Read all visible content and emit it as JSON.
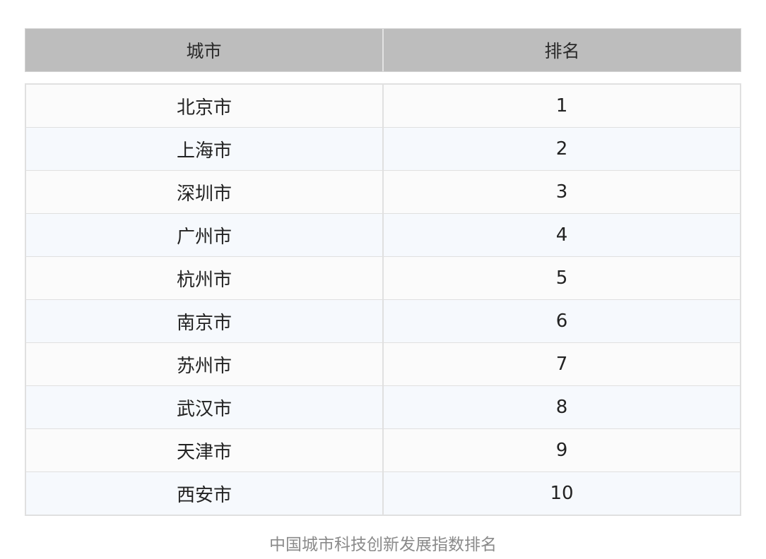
{
  "table": {
    "headers": [
      "城市",
      "排名"
    ],
    "rows": [
      {
        "city": "北京市",
        "rank": "1"
      },
      {
        "city": "上海市",
        "rank": "2"
      },
      {
        "city": "深圳市",
        "rank": "3"
      },
      {
        "city": "广州市",
        "rank": "4"
      },
      {
        "city": "杭州市",
        "rank": "5"
      },
      {
        "city": "南京市",
        "rank": "6"
      },
      {
        "city": "苏州市",
        "rank": "7"
      },
      {
        "city": "武汉市",
        "rank": "8"
      },
      {
        "city": "天津市",
        "rank": "9"
      },
      {
        "city": "西安市",
        "rank": "10"
      }
    ]
  },
  "caption": "中国城市科技创新发展指数排名",
  "colors": {
    "header_bg": "#bdbdbd",
    "row_odd_bg": "#fbfbfb",
    "row_even_bg": "#f6f9fd",
    "border": "#e0e0e0",
    "caption": "#8a8a8a"
  }
}
